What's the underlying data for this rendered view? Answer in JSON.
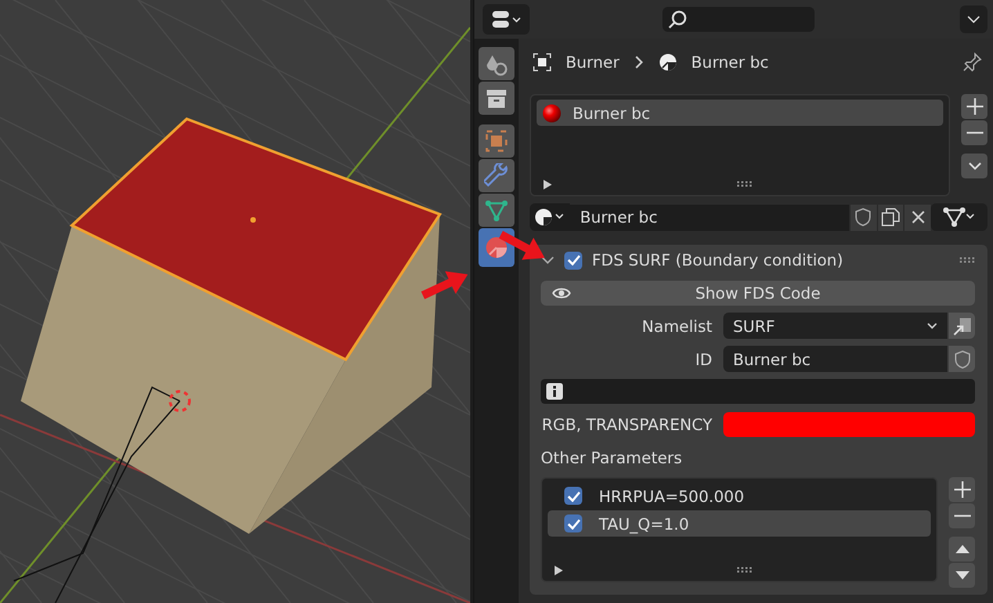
{
  "viewport": {
    "kind": "scene"
  },
  "properties": {
    "tabs": [
      {
        "kind": "tool",
        "selected": false
      },
      {
        "kind": "output",
        "selected": false
      },
      {
        "kind": "object",
        "selected": false
      },
      {
        "kind": "modifier",
        "selected": false
      },
      {
        "kind": "data",
        "selected": false
      },
      {
        "kind": "material",
        "selected": true
      }
    ],
    "breadcrumb": [
      "Burner",
      "Burner bc"
    ],
    "material_slots": [
      {
        "label": "Burner bc",
        "selected": true
      }
    ],
    "material_name": "Burner bc",
    "panel": {
      "title": "FDS SURF (Boundary condition)",
      "checked": true,
      "expanded": true,
      "show_code_button": "Show FDS Code",
      "fields": [
        {
          "label": "Namelist",
          "value": "SURF",
          "kind": "dropdown"
        },
        {
          "label": "ID",
          "value": "Burner bc",
          "kind": "text"
        }
      ],
      "color_field": {
        "label": "RGB, TRANSPARENCY",
        "color": "#ff0000"
      },
      "params_title": "Other Parameters",
      "params": [
        {
          "label": "HRRPUA=500.000",
          "checked": true,
          "selected": false
        },
        {
          "label": "TAU_Q=1.0",
          "checked": true,
          "selected": true
        }
      ]
    }
  }
}
